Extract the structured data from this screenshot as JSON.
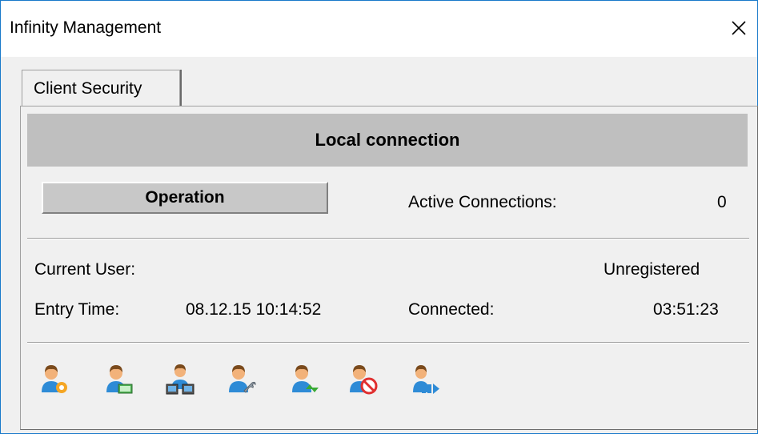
{
  "window": {
    "title": "Infinity Management",
    "close_glyph": "×"
  },
  "tabs": [
    {
      "label": "Client Security",
      "active": true
    }
  ],
  "header": {
    "title": "Local connection"
  },
  "operation_button": {
    "label": "Operation"
  },
  "active_connections": {
    "label": "Active Connections:",
    "value": "0"
  },
  "current_user": {
    "label": "Current User:",
    "value": "Unregistered"
  },
  "entry_time": {
    "label": "Entry Time:",
    "value": "08.12.15 10:14:52"
  },
  "connected": {
    "label": "Connected:",
    "value": "03:51:23"
  },
  "toolbar": {
    "icons": [
      "user-settings-icon",
      "user-edit-icon",
      "user-network-icon",
      "user-tools-icon",
      "user-sync-icon",
      "user-block-icon",
      "user-forward-icon"
    ]
  },
  "colors": {
    "window_border": "#1979ca",
    "header_bg": "#bfbfbf",
    "button_bg": "#c8c8c8",
    "user_shirt": "#2e8bd6",
    "user_skin": "#f2b27a",
    "user_hair": "#7a4a1c",
    "gear": "#f5a623",
    "block": "#e03030",
    "sync_green": "#3aaa35"
  }
}
